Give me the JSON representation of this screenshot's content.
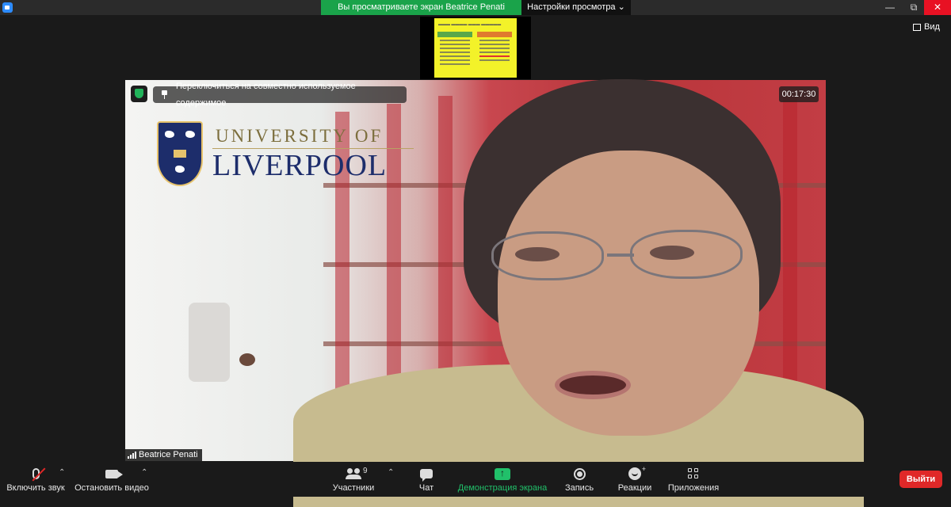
{
  "titlebar": {
    "share_banner": "Вы просматриваете экран Beatrice Penati",
    "view_options": "Настройки просмотра",
    "view_options_caret": "⌄",
    "minimize": "—",
    "maximize": "⧉",
    "close": "✕"
  },
  "top_right": {
    "view_label": "Вид"
  },
  "video": {
    "switch_label": "Переключиться на совместно используемое содержимое",
    "timer": "00:17:30",
    "participant_name": "Beatrice Penati",
    "logo_line1": "UNIVERSITY OF",
    "logo_line2": "LIVERPOOL"
  },
  "toolbar": {
    "unmute": "Включить звук",
    "stop_video": "Остановить видео",
    "participants": "Участники",
    "participants_count": "9",
    "chat": "Чат",
    "share_screen": "Демонстрация экрана",
    "record": "Запись",
    "reactions": "Реакции",
    "apps": "Приложения",
    "leave": "Выйти"
  },
  "colors": {
    "share_banner": "#1aa34a",
    "share_button": "#21c06a",
    "leave_button": "#e02828",
    "mute_slash": "#e02828",
    "security_badge": "#21b35a"
  }
}
